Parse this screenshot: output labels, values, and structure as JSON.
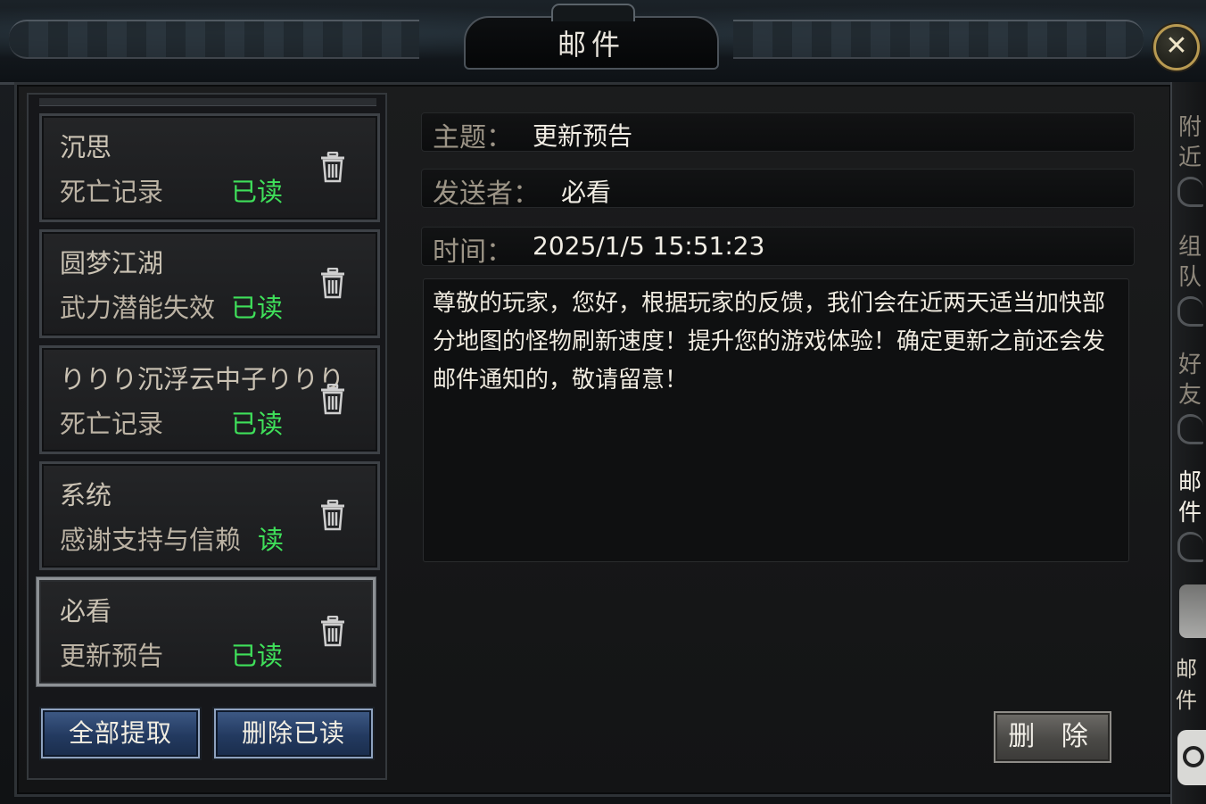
{
  "window": {
    "title": "邮件",
    "close_label": "✕"
  },
  "mail_list": [
    {
      "sender": "沉思",
      "subject": "死亡记录",
      "status": "已读",
      "selected": false
    },
    {
      "sender": "圆梦江湖",
      "subject": "武力潜能失效",
      "status": "已读",
      "selected": false
    },
    {
      "sender": "りりり沉浮云中子りりり",
      "subject": "死亡记录",
      "status": "已读",
      "selected": false
    },
    {
      "sender": "系统",
      "subject": "感谢支持与信赖",
      "status": "读",
      "selected": false
    },
    {
      "sender": "必看",
      "subject": "更新预告",
      "status": "已读",
      "selected": true
    }
  ],
  "buttons": {
    "collect_all": "全部提取",
    "delete_read": "删除已读",
    "delete": "删 除"
  },
  "detail": {
    "subject_label": "主题：",
    "subject_value": "更新预告",
    "sender_label": "发送者：",
    "sender_value": "必看",
    "time_label": "时间：",
    "time_value": "2025/1/5 15:51:23",
    "content": "尊敬的玩家，您好，根据玩家的反馈，我们会在近两天适当加快部分地图的怪物刷新速度！提升您的游戏体验！确定更新之前还会发邮件通知的，敬请留意！"
  },
  "side_tabs": [
    {
      "label": "附近",
      "active": false
    },
    {
      "label": "组队",
      "active": false
    },
    {
      "label": "好友",
      "active": false
    },
    {
      "label": "邮件",
      "active": true
    }
  ],
  "side_partial_text": "邮件",
  "colors": {
    "read_status": "#3fe05a",
    "button_blue": "#233a60",
    "close_ring": "#b89a52"
  },
  "icons": {
    "delete_mail": "trash-icon",
    "close": "close-icon"
  }
}
